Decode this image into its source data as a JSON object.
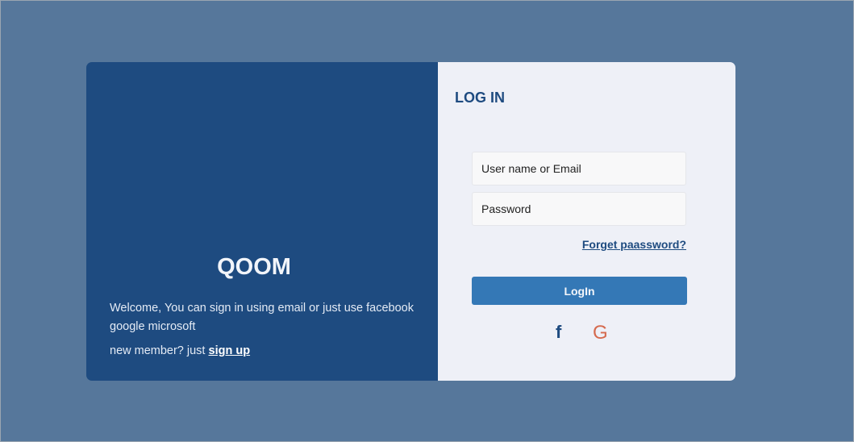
{
  "brand": "QOOM",
  "welcome": "Welcome, You can sign in using email or just use facebook google microsoft",
  "new_member": "new member? just",
  "sign_up": "sign up",
  "login": {
    "title": "LOG IN",
    "username_placeholder": "User name or Email",
    "password_placeholder": "Password",
    "forgot": "Forget paassword?",
    "button": "LogIn",
    "facebook_glyph": "f",
    "google_glyph": "G"
  },
  "icons": [
    "facebook-icon",
    "google-icon"
  ],
  "colors": {
    "page_bg": "#56779b",
    "panel": "#1e4b80",
    "button": "#3478b6",
    "google": "#d56a4e"
  }
}
